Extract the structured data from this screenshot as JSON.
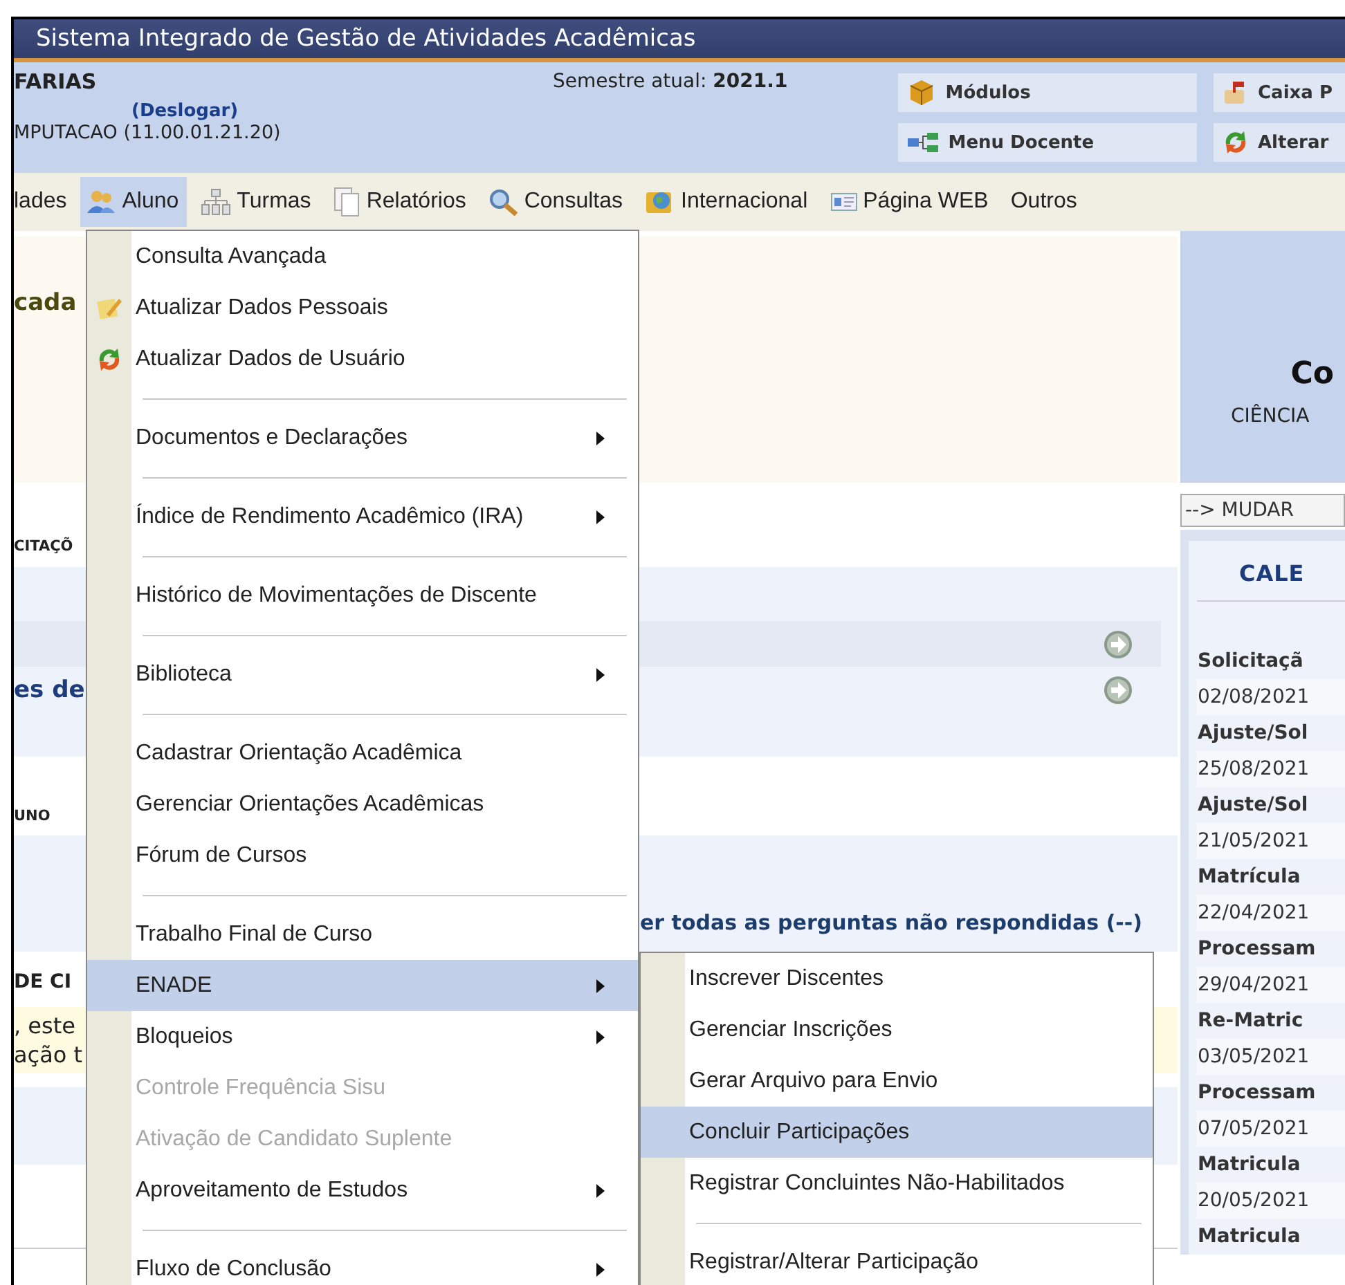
{
  "window": {
    "title": "Sistema Integrado de Gestão de Atividades Acadêmicas"
  },
  "user_bar": {
    "user_name": "FARIAS",
    "logout_link": "(Deslogar)",
    "unit": "MPUTACAO (11.00.01.21.20)",
    "semester": "Semestre atual: **2021.1**",
    "shortcuts": [
      {
        "label": "Módulos"
      },
      {
        "label": "Menu Docente"
      }
    ],
    "shortcuts_right": [
      {
        "label": "Caixa P"
      },
      {
        "label": "Alterar"
      }
    ]
  },
  "menu_bar": [
    {
      "label": "lades",
      "selected": false
    },
    {
      "label": "Aluno",
      "selected": true
    },
    {
      "label": "Turmas",
      "selected": false
    },
    {
      "label": "Relatórios",
      "selected": false
    },
    {
      "label": "Consultas",
      "selected": false
    },
    {
      "label": "Internacional",
      "selected": false
    },
    {
      "label": "Página WEB",
      "selected": false
    },
    {
      "label": "Outros",
      "selected": false
    }
  ],
  "dropdown": {
    "items": [
      {
        "kind": "item",
        "label": "Consulta Avançada",
        "submenu": false,
        "disabled": false,
        "selected": false
      },
      {
        "kind": "item",
        "label": "Atualizar Dados Pessoais",
        "submenu": false,
        "disabled": false,
        "selected": false
      },
      {
        "kind": "item",
        "label": "Atualizar Dados de Usuário",
        "submenu": false,
        "disabled": false,
        "selected": false
      },
      {
        "kind": "separator"
      },
      {
        "kind": "item",
        "label": "Documentos e Declarações",
        "submenu": true,
        "disabled": false,
        "selected": false
      },
      {
        "kind": "separator"
      },
      {
        "kind": "item",
        "label": "Índice de Rendimento Acadêmico (IRA)",
        "submenu": true,
        "disabled": false,
        "selected": false
      },
      {
        "kind": "separator"
      },
      {
        "kind": "item",
        "label": "Histórico de Movimentações de Discente",
        "submenu": false,
        "disabled": false,
        "selected": false
      },
      {
        "kind": "separator"
      },
      {
        "kind": "item",
        "label": "Biblioteca",
        "submenu": true,
        "disabled": false,
        "selected": false
      },
      {
        "kind": "separator"
      },
      {
        "kind": "item",
        "label": "Cadastrar Orientação Acadêmica",
        "submenu": false,
        "disabled": false,
        "selected": false
      },
      {
        "kind": "item",
        "label": "Gerenciar Orientações Acadêmicas",
        "submenu": false,
        "disabled": false,
        "selected": false
      },
      {
        "kind": "item",
        "label": "Fórum de Cursos",
        "submenu": false,
        "disabled": false,
        "selected": false
      },
      {
        "kind": "separator"
      },
      {
        "kind": "item",
        "label": "Trabalho Final de Curso",
        "submenu": false,
        "disabled": false,
        "selected": false
      },
      {
        "kind": "item",
        "label": "ENADE",
        "submenu": true,
        "disabled": false,
        "selected": true
      },
      {
        "kind": "item",
        "label": "Bloqueios",
        "submenu": true,
        "disabled": false,
        "selected": false
      },
      {
        "kind": "item",
        "label": "Controle Frequência Sisu",
        "submenu": false,
        "disabled": true,
        "selected": false
      },
      {
        "kind": "item",
        "label": "Ativação de Candidato Suplente",
        "submenu": false,
        "disabled": true,
        "selected": false
      },
      {
        "kind": "item",
        "label": "Aproveitamento de Estudos",
        "submenu": true,
        "disabled": false,
        "selected": false
      },
      {
        "kind": "separator"
      },
      {
        "kind": "item",
        "label": "Fluxo de Conclusão",
        "submenu": true,
        "disabled": false,
        "selected": false
      }
    ]
  },
  "submenu": {
    "items": [
      {
        "kind": "item",
        "label": "Inscrever Discentes",
        "submenu": false,
        "disabled": false,
        "selected": false
      },
      {
        "kind": "item",
        "label": "Gerenciar Inscrições",
        "submenu": false,
        "disabled": false,
        "selected": false
      },
      {
        "kind": "item",
        "label": "Gerar Arquivo para Envio",
        "submenu": false,
        "disabled": false,
        "selected": false
      },
      {
        "kind": "item",
        "label": "Concluir Participações",
        "submenu": false,
        "disabled": false,
        "selected": true
      },
      {
        "kind": "item",
        "label": "Registrar Concluintes Não-Habilitados",
        "submenu": false,
        "disabled": false,
        "selected": false
      },
      {
        "kind": "separator"
      },
      {
        "kind": "item",
        "label": "Registrar/Alterar Participação",
        "submenu": false,
        "disabled": false,
        "selected": false
      }
    ]
  },
  "main": {
    "page_title": "cada",
    "section_1": "CITAÇÕ",
    "heading_2": "es de",
    "section_2": "UNO",
    "unanswered_link": "er todas as perguntas não respondidas (--)",
    "section_3": "DE CI",
    "notice": [
      ", este",
      "ação t"
    ]
  },
  "side": {
    "title": "Co",
    "subtitle": "CIÊNCIA",
    "change_button": "--> MUDAR",
    "calendar": {
      "title": "CALE",
      "entries": [
        {
          "name": "Solicitaçã",
          "date": "02/08/2021"
        },
        {
          "name": "Ajuste/Sol",
          "date": "25/08/2021"
        },
        {
          "name": "Ajuste/Sol",
          "date": "21/05/2021"
        },
        {
          "name": "Matrícula",
          "date": "22/04/2021"
        },
        {
          "name": "Processam",
          "date": "29/04/2021"
        },
        {
          "name": "Re-Matric",
          "date": "03/05/2021"
        },
        {
          "name": "Processam",
          "date": "07/05/2021"
        },
        {
          "name": "Matricula",
          "date": "20/05/2021"
        },
        {
          "name": "Matricula"
        }
      ]
    }
  }
}
